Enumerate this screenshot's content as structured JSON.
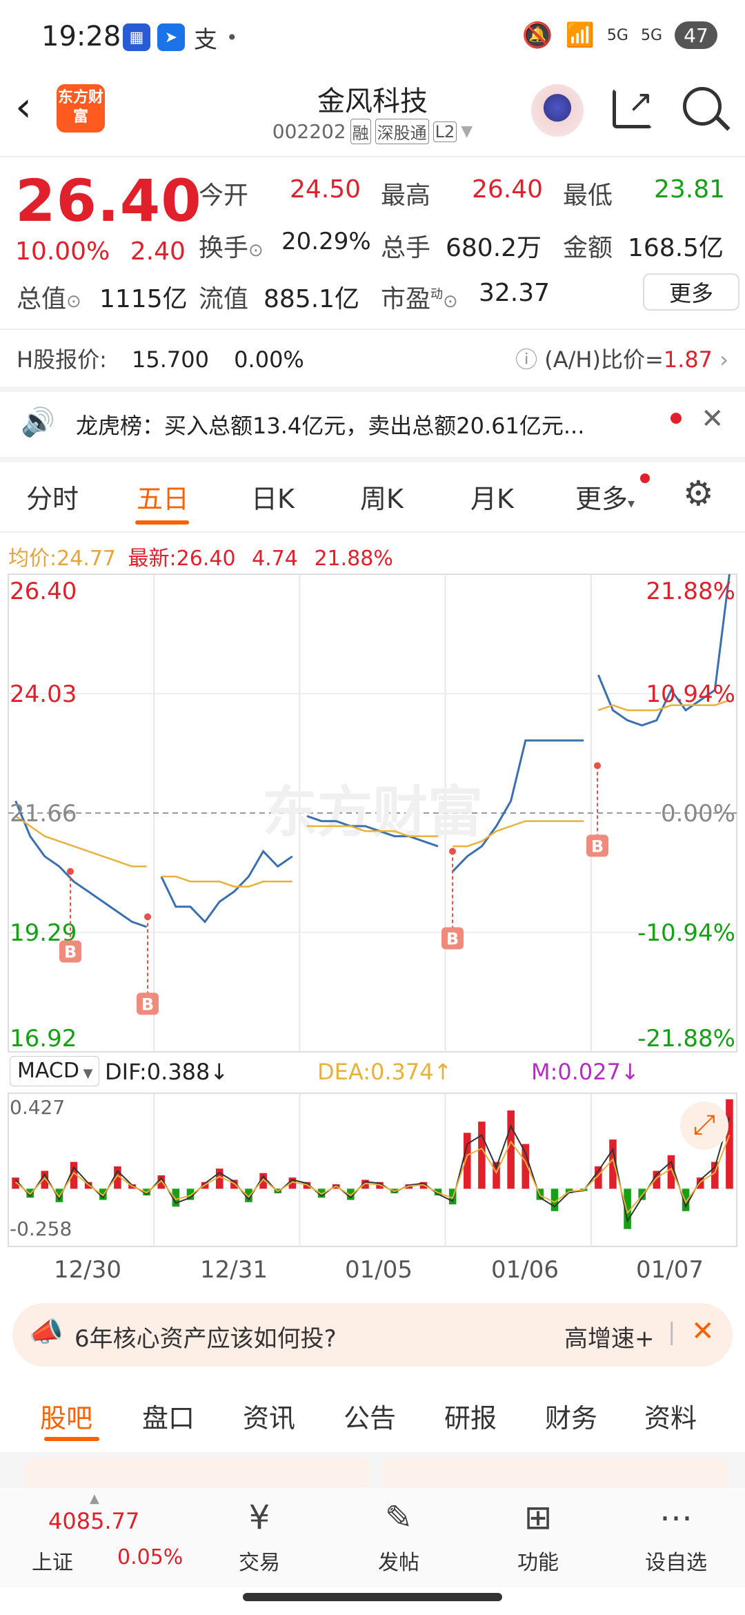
{
  "status_bar": {
    "time": "19:28",
    "app_icon_alipay": "支",
    "dot": "•",
    "signal_5g_1": "5G",
    "signal_5g_2": "5G",
    "battery": "47"
  },
  "header": {
    "brand_logo": "东方财富",
    "stock_name": "金风科技",
    "stock_code": "002202",
    "tags": [
      "融",
      "深股通",
      "L2"
    ]
  },
  "quote": {
    "price": "26.40",
    "change_pct": "10.00%",
    "change_amt": "2.40",
    "open_label": "今开",
    "open_value": "24.50",
    "high_label": "最高",
    "high_value": "26.40",
    "low_label": "最低",
    "low_value": "23.81",
    "turnover_label": "换手",
    "turnover_value": "20.29%",
    "volume_label": "总手",
    "volume_value": "680.2万",
    "amount_label": "金额",
    "amount_value": "168.5亿",
    "mktcap_label": "总值",
    "mktcap_value": "1115亿",
    "float_label": "流值",
    "float_value": "885.1亿",
    "pe_label": "市盈",
    "pe_sup": "动",
    "pe_value": "32.37",
    "more_button": "更多"
  },
  "h_share": {
    "label": "H股报价:",
    "price": "15.700",
    "pct": "0.00%",
    "ratio_label": "(A/H)比价=",
    "ratio_value": "1.87"
  },
  "notice": {
    "text": "龙虎榜：买入总额13.4亿元，卖出总额20.61亿元..."
  },
  "chart_tabs": {
    "tabs": [
      "分时",
      "五日",
      "日K",
      "周K",
      "月K",
      "更多"
    ],
    "active": "五日"
  },
  "avg_row": {
    "avg_label": "均价:",
    "avg_value": "24.77",
    "latest_label": "最新:",
    "latest_value": "26.40",
    "latest_chg": "4.74",
    "latest_pct": "21.88%"
  },
  "chart_data": [
    {
      "type": "line",
      "title": "",
      "x": [
        "12/30",
        "12/31",
        "01/05",
        "01/06",
        "01/07"
      ],
      "y_tick_labels_left": [
        "26.40",
        "24.03",
        "21.66",
        "19.29",
        "16.92"
      ],
      "y_tick_labels_right": [
        "21.88%",
        "10.94%",
        "0.00%",
        "-10.94%",
        "-21.88%"
      ],
      "ylim": [
        16.92,
        26.4
      ],
      "reference_line": 21.66,
      "watermark": "东方财富",
      "series": [
        {
          "name": "",
          "color": "#3a6fb0",
          "values": [
            21.9,
            21.2,
            20.8,
            20.6,
            20.3,
            20.1,
            19.9,
            19.7,
            19.5,
            19.4,
            20.4,
            19.8,
            19.8,
            19.5,
            19.9,
            20.1,
            20.4,
            20.9,
            20.6,
            20.8,
            21.6,
            21.5,
            21.5,
            21.4,
            21.4,
            21.3,
            21.2,
            21.2,
            21.1,
            21.0,
            20.5,
            20.8,
            21.0,
            21.4,
            21.9,
            23.1,
            23.1,
            23.1,
            23.1,
            23.1,
            24.4,
            23.7,
            23.5,
            23.4,
            23.5,
            24.1,
            23.7,
            23.9,
            24.1,
            26.4
          ]
        },
        {
          "name": "",
          "color": "#e8b23a",
          "values": [
            21.6,
            21.4,
            21.2,
            21.1,
            21.0,
            20.9,
            20.8,
            20.7,
            20.6,
            20.6,
            20.4,
            20.4,
            20.3,
            20.3,
            20.3,
            20.2,
            20.2,
            20.3,
            20.3,
            20.3,
            21.4,
            21.4,
            21.4,
            21.4,
            21.3,
            21.3,
            21.3,
            21.2,
            21.2,
            21.2,
            21.0,
            21.0,
            21.1,
            21.3,
            21.4,
            21.5,
            21.5,
            21.5,
            21.5,
            21.5,
            23.7,
            23.8,
            23.7,
            23.7,
            23.7,
            23.8,
            23.8,
            23.8,
            23.8,
            23.9
          ]
        }
      ],
      "markers": [
        {
          "label": "B",
          "day": 0
        },
        {
          "label": "B",
          "day": 0
        },
        {
          "label": "B",
          "day": 2
        },
        {
          "label": "B",
          "day": 3
        }
      ]
    },
    {
      "type": "bar",
      "title": "MACD",
      "selector_label": "MACD",
      "dif_label": "DIF:0.388",
      "dif_arrow": "↓",
      "dea_label": "DEA:0.374",
      "dea_arrow": "↑",
      "m_label": "M:0.027",
      "m_arrow": "↓",
      "y_top_label": "0.427",
      "y_bottom_label": "-0.258",
      "ylim": [
        -0.258,
        0.427
      ],
      "values": [
        0.05,
        -0.04,
        0.08,
        -0.06,
        0.12,
        0.03,
        -0.05,
        0.1,
        0.02,
        -0.03,
        0.06,
        -0.08,
        -0.05,
        0.03,
        0.09,
        0.04,
        -0.06,
        0.07,
        -0.02,
        0.05,
        0.03,
        -0.04,
        0.02,
        -0.05,
        0.04,
        0.03,
        -0.02,
        0.02,
        0.03,
        -0.03,
        -0.07,
        0.25,
        0.3,
        0.12,
        0.35,
        0.2,
        -0.05,
        -0.1,
        -0.02,
        -0.01,
        0.1,
        0.22,
        -0.18,
        -0.05,
        0.08,
        0.15,
        -0.1,
        0.05,
        0.12,
        0.4
      ]
    }
  ],
  "ad": {
    "text": "6年核心资产应该如何投?",
    "right_text": "高增速+",
    "sep": "|"
  },
  "bottom_tabs": {
    "tabs": [
      "股吧",
      "盘口",
      "资讯",
      "公告",
      "研报",
      "财务",
      "资料"
    ],
    "active": "股吧"
  },
  "nav": {
    "index_value": "4085.77",
    "index_name": "上证",
    "index_pct": "0.05%",
    "items": [
      "交易",
      "发帖",
      "功能",
      "设自选"
    ]
  }
}
